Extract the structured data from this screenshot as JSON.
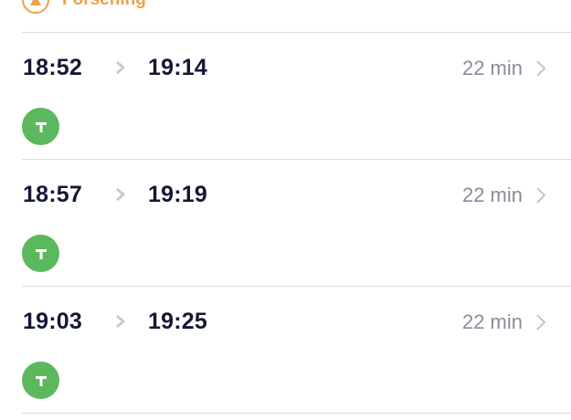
{
  "status": {
    "delay_label": "Forsening",
    "accent_color": "#f0a04b",
    "icon": "warning-icon"
  },
  "trips": [
    {
      "departure": "18:52",
      "arrival": "19:14",
      "duration": "22 min",
      "mode_icon": "tbane-icon",
      "mode_color": "#5cb85c"
    },
    {
      "departure": "18:57",
      "arrival": "19:19",
      "duration": "22 min",
      "mode_icon": "tbane-icon",
      "mode_color": "#5cb85c"
    },
    {
      "departure": "19:03",
      "arrival": "19:25",
      "duration": "22 min",
      "mode_icon": "tbane-icon",
      "mode_color": "#5cb85c"
    }
  ]
}
